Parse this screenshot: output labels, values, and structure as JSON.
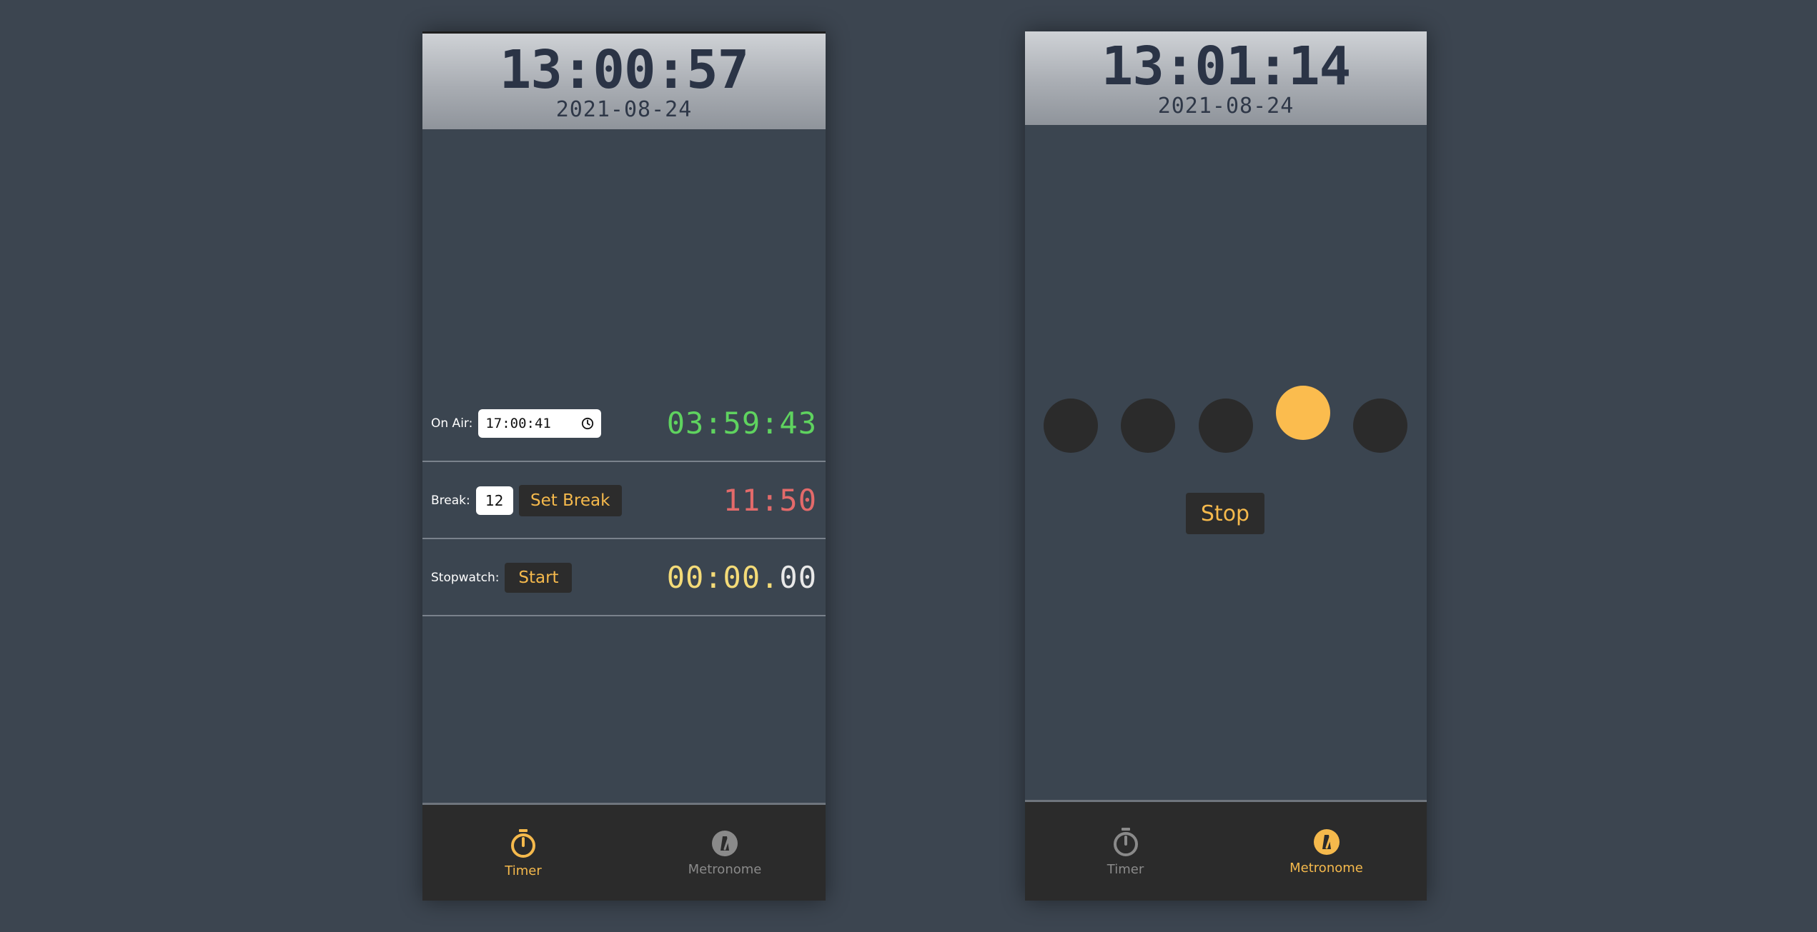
{
  "timer_screen": {
    "clock": {
      "time": "13:00:57",
      "date": "2021-08-24"
    },
    "on_air": {
      "label": "On Air:",
      "input_value": "17:00:41",
      "countdown": "03:59:43"
    },
    "break": {
      "label": "Break:",
      "input_value": "12",
      "button_label": "Set Break",
      "countdown": "11:50"
    },
    "stopwatch": {
      "label": "Stopwatch:",
      "button_label": "Start",
      "time_main": "00:00.",
      "time_fraction": "00"
    },
    "nav": [
      {
        "label": "Timer",
        "icon": "stopwatch-icon",
        "active": true
      },
      {
        "label": "Metronome",
        "icon": "metronome-icon",
        "active": false
      }
    ]
  },
  "metronome_screen": {
    "clock": {
      "time": "13:01:14",
      "date": "2021-08-24"
    },
    "beats": [
      {
        "active": false
      },
      {
        "active": false
      },
      {
        "active": false
      },
      {
        "active": true
      },
      {
        "active": false
      }
    ],
    "stop_label": "Stop",
    "nav": [
      {
        "label": "Timer",
        "icon": "stopwatch-icon",
        "active": false
      },
      {
        "label": "Metronome",
        "icon": "metronome-icon",
        "active": true
      }
    ]
  },
  "colors": {
    "background": "#3c4550",
    "accent": "#f5b94c",
    "on_air_green": "#5fd35f",
    "break_red": "#e36a6a",
    "stopwatch_yellow": "#f4db78",
    "nav_bg": "#2b2b2b"
  }
}
